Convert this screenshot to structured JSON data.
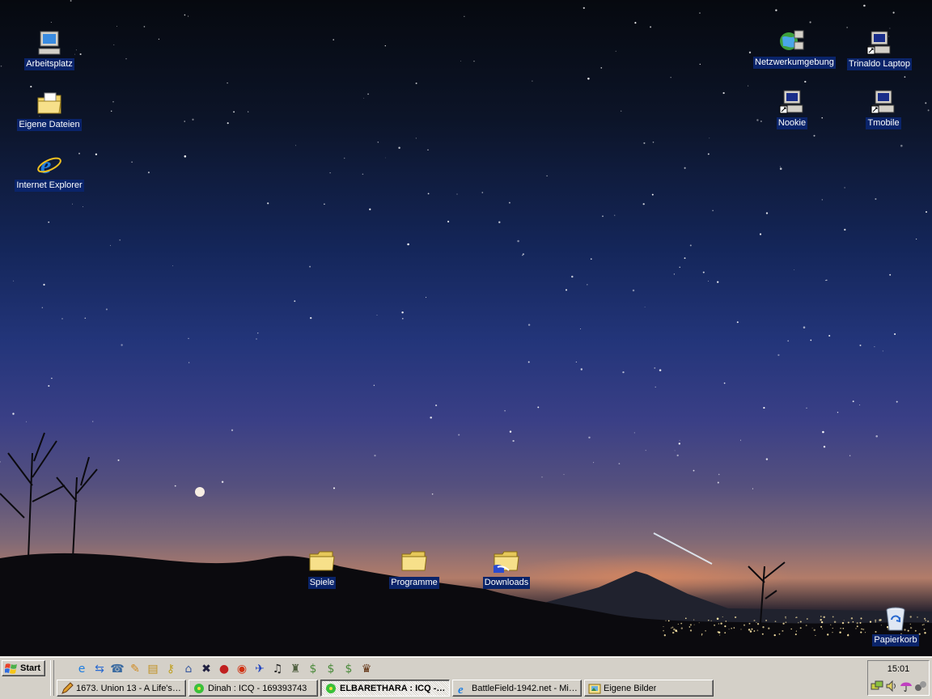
{
  "desktop": {
    "icons": [
      {
        "label": "Arbeitsplatz",
        "icon": "my-computer-icon"
      },
      {
        "label": "Eigene Dateien",
        "icon": "my-documents-folder-icon"
      },
      {
        "label": "Internet Explorer",
        "icon": "internet-explorer-icon"
      },
      {
        "label": "Netzwerkumgebung",
        "icon": "network-neighborhood-icon"
      },
      {
        "label": "Trinaldo Laptop",
        "icon": "remote-computer-shortcut-icon"
      },
      {
        "label": "Nookie",
        "icon": "remote-computer-shortcut-icon"
      },
      {
        "label": "Tmobile",
        "icon": "remote-computer-shortcut-icon"
      },
      {
        "label": "Spiele",
        "icon": "folder-icon"
      },
      {
        "label": "Programme",
        "icon": "folder-icon"
      },
      {
        "label": "Downloads",
        "icon": "shared-folder-icon"
      },
      {
        "label": "Papierkorb",
        "icon": "recycle-bin-icon"
      }
    ]
  },
  "taskbar": {
    "start_label": "Start",
    "quick_launch": [
      "show-desktop-icon",
      "internet-explorer-icon",
      "network-icon",
      "phone-dialer-icon",
      "pencil-icon",
      "explorer-icon",
      "keys-icon",
      "dialup-icon",
      "app-icon",
      "red-helmet-icon",
      "record-icon",
      "plane-icon",
      "headphones-icon",
      "game-icon",
      "money-icon",
      "money-icon",
      "money-icon",
      "emblem-icon"
    ],
    "tasks": [
      {
        "label": "1673. Union 13 - A Life's ...",
        "icon": "pencil-icon",
        "active": false
      },
      {
        "label": "Dinah : ICQ - 169393743",
        "icon": "icq-flower-icon",
        "active": false
      },
      {
        "label": "ELBARETHARA : ICQ - 16...",
        "icon": "icq-flower-icon",
        "active": true
      },
      {
        "label": "BattleField-1942.net - Mic...",
        "icon": "internet-explorer-icon",
        "active": false
      },
      {
        "label": "Eigene Bilder",
        "icon": "picture-folder-icon",
        "active": false
      }
    ],
    "tray": {
      "time": "15:01",
      "icons": [
        "network-icon",
        "volume-icon",
        "umbrella-icon",
        "connection-icon"
      ]
    }
  }
}
